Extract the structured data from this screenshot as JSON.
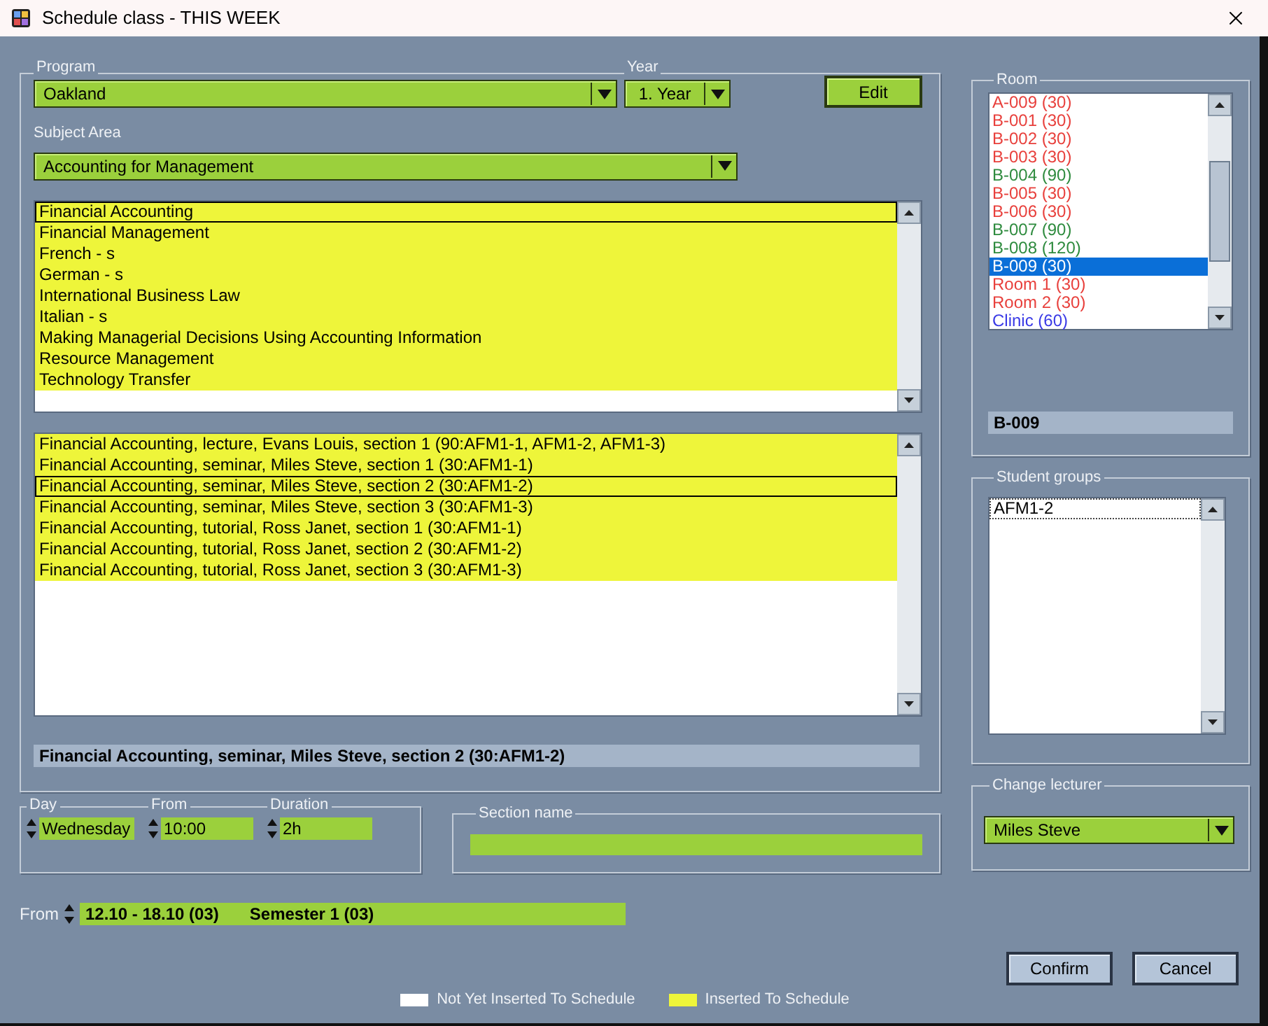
{
  "window": {
    "title": "Schedule class - THIS WEEK"
  },
  "program": {
    "label": "Program",
    "value": "Oakland"
  },
  "year": {
    "label": "Year",
    "value": "1. Year"
  },
  "edit_button": "Edit",
  "subject_area": {
    "label": "Subject Area",
    "value": "Accounting for Management"
  },
  "subjects": [
    {
      "name": "Financial Accounting",
      "inserted": true,
      "selected": true
    },
    {
      "name": "Financial Management",
      "inserted": true,
      "selected": false
    },
    {
      "name": "French  - s",
      "inserted": true,
      "selected": false
    },
    {
      "name": "German - s",
      "inserted": true,
      "selected": false
    },
    {
      "name": "International Business Law",
      "inserted": true,
      "selected": false
    },
    {
      "name": "Italian - s",
      "inserted": true,
      "selected": false
    },
    {
      "name": "Making Managerial Decisions Using Accounting Information",
      "inserted": true,
      "selected": false
    },
    {
      "name": "Resource Management",
      "inserted": true,
      "selected": false
    },
    {
      "name": "Technology Transfer",
      "inserted": true,
      "selected": false
    }
  ],
  "sections": [
    {
      "name": "Financial Accounting, lecture, Evans Louis, section 1 (90:AFM1-1, AFM1-2, AFM1-3)",
      "inserted": true,
      "selected": false
    },
    {
      "name": "Financial Accounting, seminar, Miles Steve, section 1 (30:AFM1-1)",
      "inserted": true,
      "selected": false
    },
    {
      "name": "Financial Accounting, seminar, Miles Steve, section 2 (30:AFM1-2)",
      "inserted": true,
      "selected": true
    },
    {
      "name": "Financial Accounting, seminar, Miles Steve, section 3 (30:AFM1-3)",
      "inserted": true,
      "selected": false
    },
    {
      "name": "Financial Accounting, tutorial, Ross Janet, section 1 (30:AFM1-1)",
      "inserted": true,
      "selected": false
    },
    {
      "name": "Financial Accounting, tutorial, Ross Janet, section 2 (30:AFM1-2)",
      "inserted": true,
      "selected": false
    },
    {
      "name": "Financial Accounting, tutorial, Ross Janet, section 3 (30:AFM1-3)",
      "inserted": true,
      "selected": false
    }
  ],
  "selected_section": "Financial Accounting, seminar, Miles Steve, section 2 (30:AFM1-2)",
  "day": {
    "label": "Day",
    "value": "Wednesday"
  },
  "from_time": {
    "label": "From",
    "value": "10:00"
  },
  "duration": {
    "label": "Duration",
    "value": "2h"
  },
  "section_name": {
    "label": "Section name"
  },
  "week": {
    "label": "From",
    "range": "12.10 - 18.10 (03)",
    "semester": "Semester 1 (03)"
  },
  "room": {
    "label": "Room",
    "items": [
      {
        "name": "A-009 (30)",
        "color": "#e8403c",
        "selected": false
      },
      {
        "name": "B-001 (30)",
        "color": "#e8403c",
        "selected": false
      },
      {
        "name": "B-002 (30)",
        "color": "#e8403c",
        "selected": false
      },
      {
        "name": "B-003 (30)",
        "color": "#e8403c",
        "selected": false
      },
      {
        "name": "B-004 (90)",
        "color": "#2e8b3e",
        "selected": false
      },
      {
        "name": "B-005 (30)",
        "color": "#e8403c",
        "selected": false
      },
      {
        "name": "B-006 (30)",
        "color": "#e8403c",
        "selected": false
      },
      {
        "name": "B-007 (90)",
        "color": "#2e8b3e",
        "selected": false
      },
      {
        "name": "B-008 (120)",
        "color": "#2e8b3e",
        "selected": false
      },
      {
        "name": "B-009 (30)",
        "selected": true
      },
      {
        "name": "Room 1 (30)",
        "color": "#e8403c",
        "selected": false
      },
      {
        "name": "Room 2 (30)",
        "color": "#e8403c",
        "selected": false
      },
      {
        "name": "Clinic (60)",
        "color": "#3a3ae6",
        "selected": false
      }
    ],
    "value": "B-009"
  },
  "student_groups": {
    "label": "Student groups",
    "items": [
      {
        "name": "AFM1-2",
        "selected": true
      }
    ]
  },
  "lecturer": {
    "label": "Change lecturer",
    "value": "Miles Steve"
  },
  "buttons": [
    "Confirm",
    "Cancel"
  ],
  "legend": [
    {
      "label": "Not Yet Inserted To Schedule",
      "color": "#ffffff"
    },
    {
      "label": "Inserted To Schedule",
      "color": "#eef53a"
    }
  ]
}
